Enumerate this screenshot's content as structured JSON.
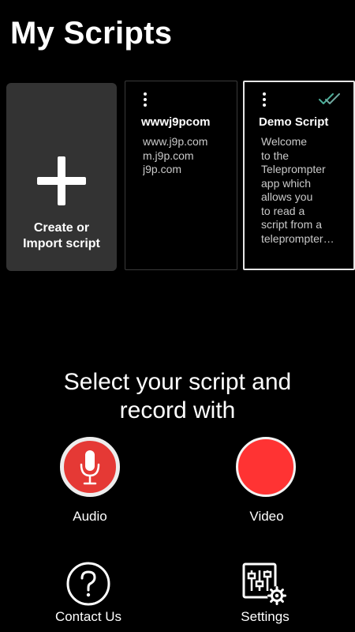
{
  "header": {
    "title": "My Scripts"
  },
  "create_card": {
    "label_line1": "Create or",
    "label_line2": "Import script",
    "icon": "plus-icon"
  },
  "scripts": [
    {
      "title": "wwwj9pcom",
      "preview_lines": [
        "www.j9p.com",
        "m.j9p.com",
        "j9p.com"
      ],
      "selected": false
    },
    {
      "title": "Demo Script",
      "preview_lines": [
        "Welcome",
        "to the",
        "Teleprompter",
        "app which",
        "allows you",
        "to read a",
        "script from a",
        "teleprompter…"
      ],
      "selected": true,
      "selected_icon": "double-check-icon"
    }
  ],
  "prompt": {
    "line1": "Select your script and",
    "line2": "record with"
  },
  "record": {
    "audio_label": "Audio",
    "video_label": "Video",
    "audio_icon": "microphone-icon",
    "video_icon": "record-dot-icon"
  },
  "footer": {
    "contact_label": "Contact Us",
    "settings_label": "Settings",
    "contact_icon": "help-circle-icon",
    "settings_icon": "settings-sliders-icon"
  },
  "colors": {
    "background": "#000000",
    "card_bg": "#333333",
    "record_red": "#e53935",
    "video_red": "#ff3333",
    "check_green": "#4caf9a"
  }
}
